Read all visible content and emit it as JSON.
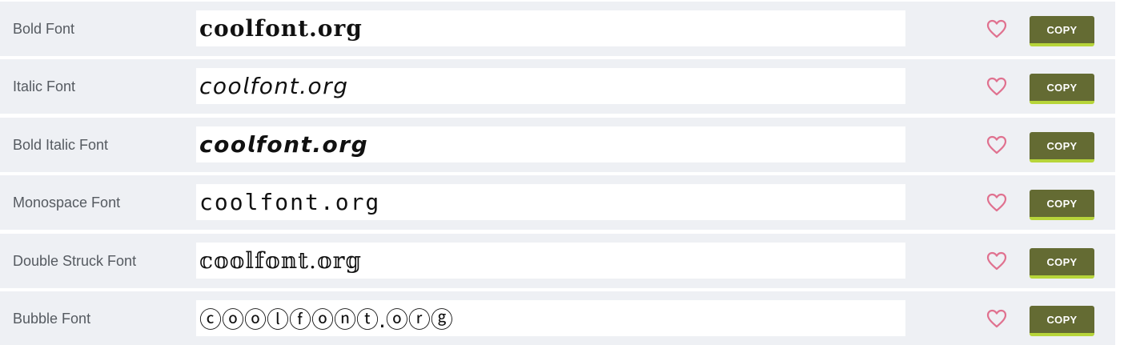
{
  "rows": [
    {
      "label": "Bold Font",
      "output": "𝐜𝐨𝐨𝐥𝐟𝐨𝐧𝐭.𝐨𝐫𝐠",
      "style": "f-bold",
      "copy_label": "COPY"
    },
    {
      "label": "Italic Font",
      "output": "𝘤𝘰𝘰𝘭𝘧𝘰𝘯𝘵.𝘰𝘳𝘨",
      "style": "f-italic",
      "copy_label": "COPY"
    },
    {
      "label": "Bold Italic Font",
      "output": "𝙘𝙤𝙤𝙡𝙛𝙤𝙣𝙩.𝙤𝙧𝙜",
      "style": "f-bolditalic",
      "copy_label": "COPY"
    },
    {
      "label": "Monospace Font",
      "output": "𝚌𝚘𝚘𝚕𝚏𝚘𝚗𝚝.𝚘𝚛𝚐",
      "style": "f-mono",
      "copy_label": "COPY"
    },
    {
      "label": "Double Struck Font",
      "output": "𝕔𝕠𝕠𝕝𝕗𝕠𝕟𝕥.𝕠𝕣𝕘",
      "style": "f-double",
      "copy_label": "COPY"
    },
    {
      "label": "Bubble Font",
      "output": "ⓒⓞⓞⓛⓕⓞⓝⓣ.ⓞⓡⓖ",
      "style": "f-bubble",
      "copy_label": "COPY"
    }
  ],
  "icons": {
    "favorite": "heart-outline-icon"
  },
  "colors": {
    "row_background": "#eef0f4",
    "copy_button": "#646b33",
    "copy_button_accent": "#b7d53a",
    "heart": "#e0718f",
    "label_text": "#555a60"
  }
}
